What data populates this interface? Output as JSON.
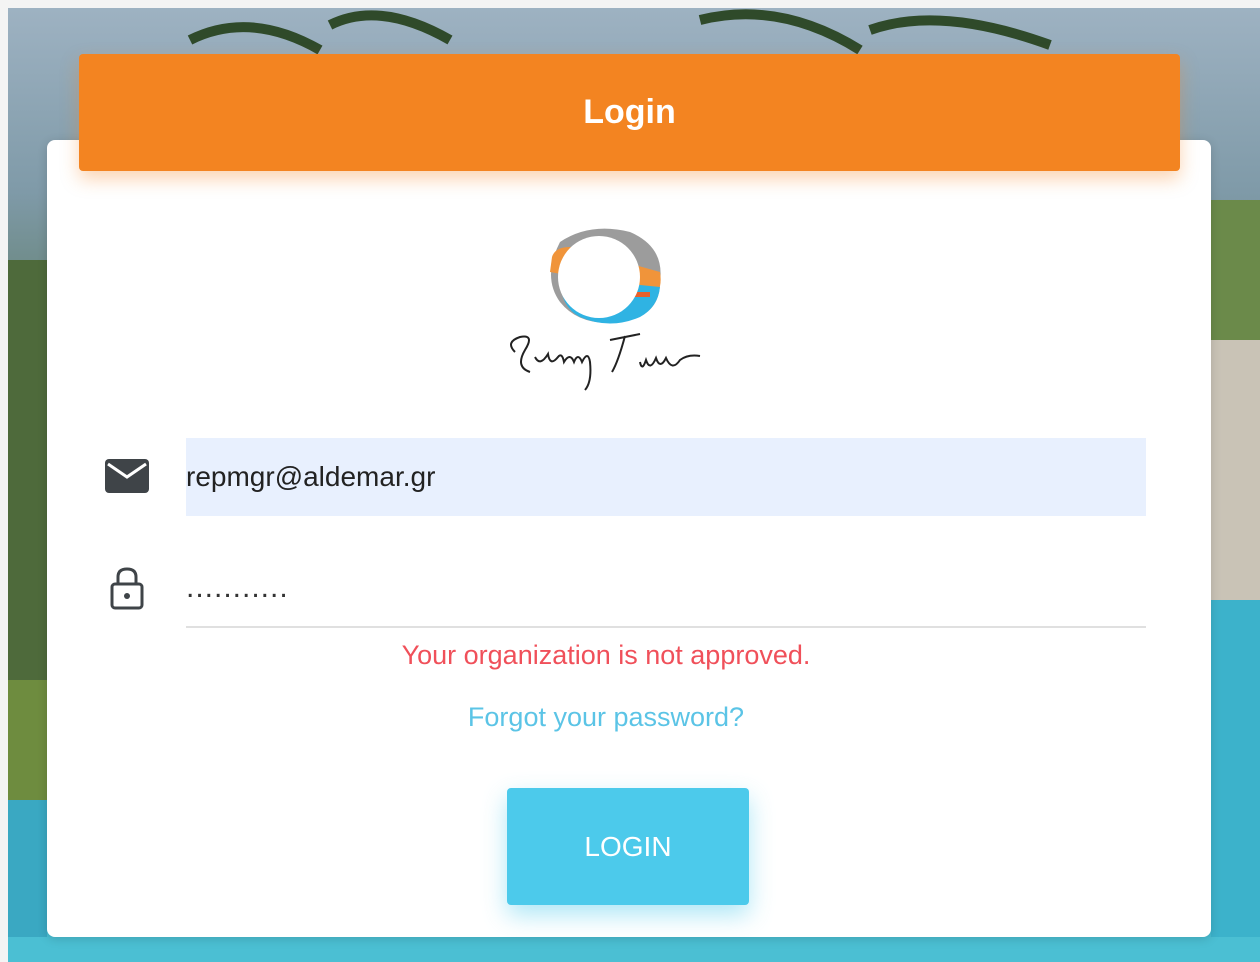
{
  "header": {
    "title": "Login"
  },
  "brand": {
    "logo_text": "Sunny Time",
    "accent_color": "#f38421",
    "primary_color": "#4ccaeb"
  },
  "form": {
    "email": {
      "value": "repmgr@aldemar.gr",
      "icon": "mail-icon"
    },
    "password": {
      "value": "...........",
      "icon": "lock-icon"
    },
    "error_message": "Your organization is not approved.",
    "forgot_link": "Forgot your password?",
    "submit_label": "LOGIN"
  }
}
